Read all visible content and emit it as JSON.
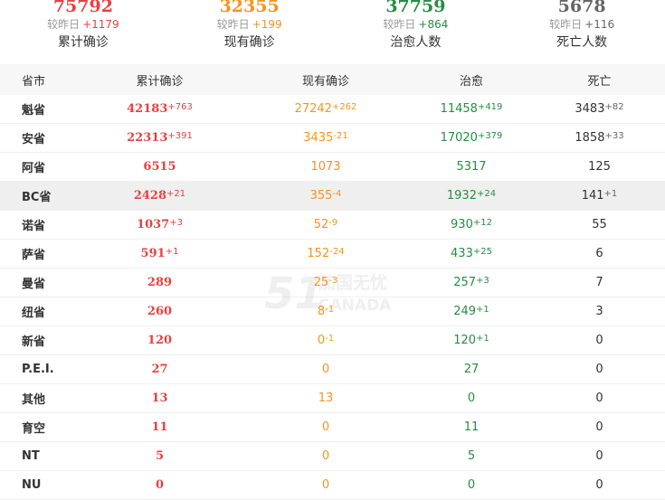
{
  "summary": [
    {
      "value": "75792",
      "diff_label": "较昨日",
      "diff": "+1179",
      "label": "累计确诊",
      "color": "#e84141"
    },
    {
      "value": "32355",
      "diff_label": "较昨日",
      "diff": "+199",
      "label": "现有确诊",
      "color": "#f7931e"
    },
    {
      "value": "37759",
      "diff_label": "较昨日",
      "diff": "+864",
      "label": "治愈人数",
      "color": "#268d42"
    },
    {
      "value": "5678",
      "diff_label": "较昨日",
      "diff": "+116",
      "label": "死亡人数",
      "color": "#666666"
    }
  ],
  "table": {
    "headers": [
      "省市",
      "累计确诊",
      "现有确诊",
      "治愈",
      "死亡"
    ],
    "rows": [
      {
        "province": "魁省",
        "total": "42183",
        "total_d": "+763",
        "current": "27242",
        "current_d": "+262",
        "cured": "11458",
        "cured_d": "+419",
        "dead": "3483",
        "dead_d": "+82"
      },
      {
        "province": "安省",
        "total": "22313",
        "total_d": "+391",
        "current": "3435",
        "current_d": "-21",
        "cured": "17020",
        "cured_d": "+379",
        "dead": "1858",
        "dead_d": "+33"
      },
      {
        "province": "阿省",
        "total": "6515",
        "total_d": "",
        "current": "1073",
        "current_d": "",
        "cured": "5317",
        "cured_d": "",
        "dead": "125",
        "dead_d": ""
      },
      {
        "province": "BC省",
        "total": "2428",
        "total_d": "+21",
        "current": "355",
        "current_d": "-4",
        "cured": "1932",
        "cured_d": "+24",
        "dead": "141",
        "dead_d": "+1"
      },
      {
        "province": "诺省",
        "total": "1037",
        "total_d": "+3",
        "current": "52",
        "current_d": "-9",
        "cured": "930",
        "cured_d": "+12",
        "dead": "55",
        "dead_d": ""
      },
      {
        "province": "萨省",
        "total": "591",
        "total_d": "+1",
        "current": "152",
        "current_d": "-24",
        "cured": "433",
        "cured_d": "+25",
        "dead": "6",
        "dead_d": ""
      },
      {
        "province": "曼省",
        "total": "289",
        "total_d": "",
        "current": "25",
        "current_d": "-3",
        "cured": "257",
        "cured_d": "+3",
        "dead": "7",
        "dead_d": ""
      },
      {
        "province": "纽省",
        "total": "260",
        "total_d": "",
        "current": "8",
        "current_d": "-1",
        "cured": "249",
        "cured_d": "+1",
        "dead": "3",
        "dead_d": ""
      },
      {
        "province": "新省",
        "total": "120",
        "total_d": "",
        "current": "0",
        "current_d": "-1",
        "cured": "120",
        "cured_d": "+1",
        "dead": "0",
        "dead_d": ""
      },
      {
        "province": "P.E.I.",
        "total": "27",
        "total_d": "",
        "current": "0",
        "current_d": "",
        "cured": "27",
        "cured_d": "",
        "dead": "0",
        "dead_d": ""
      },
      {
        "province": "其他",
        "total": "13",
        "total_d": "",
        "current": "13",
        "current_d": "",
        "cured": "0",
        "cured_d": "",
        "dead": "0",
        "dead_d": ""
      },
      {
        "province": "育空",
        "total": "11",
        "total_d": "",
        "current": "0",
        "current_d": "",
        "cured": "11",
        "cured_d": "",
        "dead": "0",
        "dead_d": ""
      },
      {
        "province": "NT",
        "total": "5",
        "total_d": "",
        "current": "0",
        "current_d": "",
        "cured": "5",
        "cured_d": "",
        "dead": "0",
        "dead_d": ""
      },
      {
        "province": "NU",
        "total": "0",
        "total_d": "",
        "current": "0",
        "current_d": "",
        "cured": "0",
        "cured_d": "",
        "dead": "0",
        "dead_d": ""
      }
    ],
    "highlight_row": "BC省"
  },
  "watermark": {
    "brand": "51",
    "cn": "加国无忧",
    "en": "CANADA"
  }
}
